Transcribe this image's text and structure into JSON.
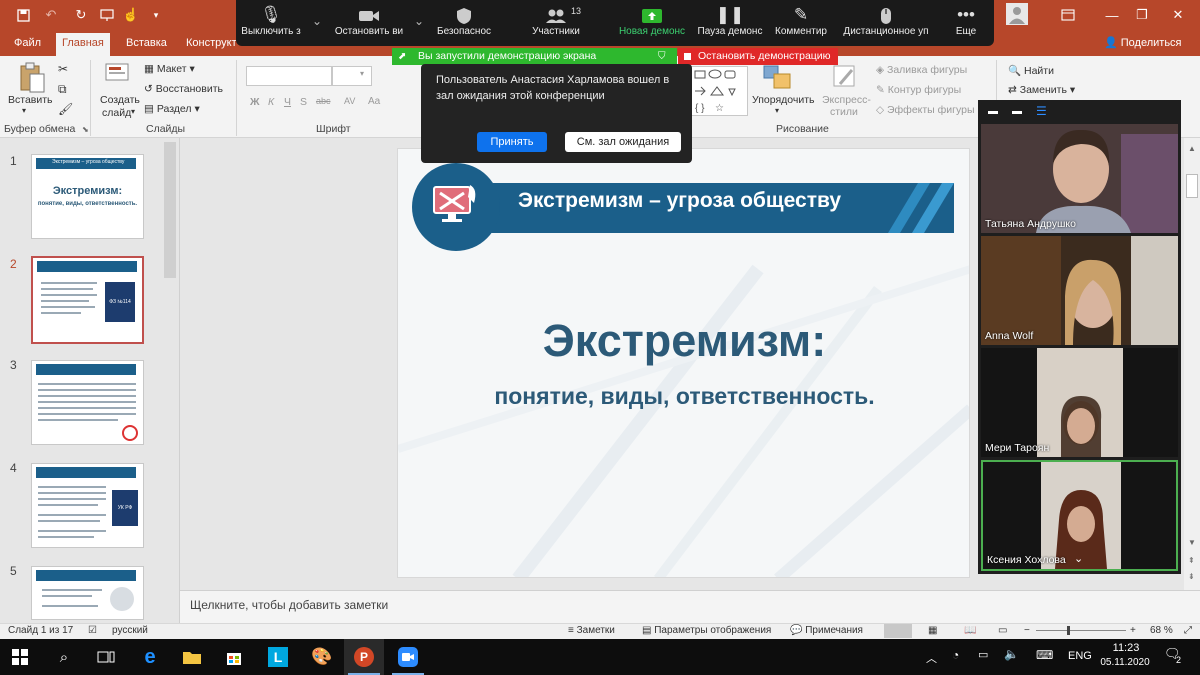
{
  "app": {
    "share_label": "Поделиться"
  },
  "ribbon_tabs": [
    "Файл",
    "Главная",
    "Вставка",
    "Конструкт"
  ],
  "ribbon": {
    "paste": "Вставить",
    "create_slide": "Создать",
    "slide": "слайд",
    "layout": "Макет",
    "reset": "Восстановить",
    "section": "Раздел",
    "arrange": "Упорядочить",
    "quick_styles": "Экспресс-",
    "quick_styles2": "стили",
    "shape_fill": "Заливка фигуры",
    "shape_outline": "Контур фигуры",
    "shape_effects": "Эффекты фигуры",
    "find": "Найти",
    "replace": "Заменить",
    "font_formats": [
      "Ж",
      "К",
      "Ч",
      "S",
      "abc",
      "AV",
      "Aa"
    ],
    "groups": {
      "clipboard": "Буфер обмена",
      "slides": "Слайды",
      "font": "Шрифт",
      "drawing": "Рисование"
    }
  },
  "zoom_toolbar": {
    "buttons": [
      {
        "label": "Выключить з",
        "icon": "microphone-icon"
      },
      {
        "label": "Остановить ви",
        "icon": "video-camera-icon"
      },
      {
        "label": "Безопаснос",
        "icon": "shield-icon"
      },
      {
        "label": "Участники",
        "icon": "participants-icon",
        "count": "13"
      },
      {
        "label": "Новая демонс",
        "icon": "share-screen-icon"
      },
      {
        "label": "Пауза демонс",
        "icon": "pause-icon"
      },
      {
        "label": "Комментир",
        "icon": "pencil-icon"
      },
      {
        "label": "Дистанционное уп",
        "icon": "mouse-icon"
      },
      {
        "label": "Еще",
        "icon": "more-icon"
      }
    ],
    "sharing_banner": "Вы запустили демонстрацию экрана",
    "stop_share": "Остановить демонстрацию",
    "notification": "Пользователь Анастасия Харламова вошел в зал ожидания этой конференции",
    "accept_button": "Принять",
    "view_waiting_button": "См. зал ожидания"
  },
  "slides": [
    {
      "number": "1",
      "title": "Экстремизм – угроза обществу",
      "heading": "Экстремизм:",
      "sub": "понятие, виды, ответственность."
    },
    {
      "number": "2",
      "tag": "ФЗ №114"
    },
    {
      "number": "3"
    },
    {
      "number": "4",
      "tag": "УК РФ"
    },
    {
      "number": "5"
    }
  ],
  "main_slide": {
    "banner_title": "Экстремизм – угроза обществу",
    "heading": "Экстремизм:",
    "subheading": "понятие, виды, ответственность."
  },
  "participants": [
    {
      "name": "Татьяна Андрушко"
    },
    {
      "name": "Anna Wolf"
    },
    {
      "name": "Мери Тароян"
    },
    {
      "name": "Ксения Хохлова"
    }
  ],
  "notes_placeholder": "Щелкните, чтобы добавить заметки",
  "status_bar": {
    "slide_info": "Слайд 1 из 17",
    "language": "русский",
    "notes": "Заметки",
    "display_settings": "Параметры отображения",
    "comments": "Примечания",
    "zoom": "68 %"
  },
  "taskbar": {
    "language": "ENG",
    "time": "11:23",
    "date": "05.11.2020",
    "notification_count": "2"
  },
  "colors": {
    "ppt_red": "#b7472a",
    "slide_blue": "#1b5f8a",
    "slide_text": "#2c5a78",
    "zoom_green": "#2eb82e",
    "zoom_red": "#e02828",
    "zoom_blue": "#0e72ed"
  }
}
